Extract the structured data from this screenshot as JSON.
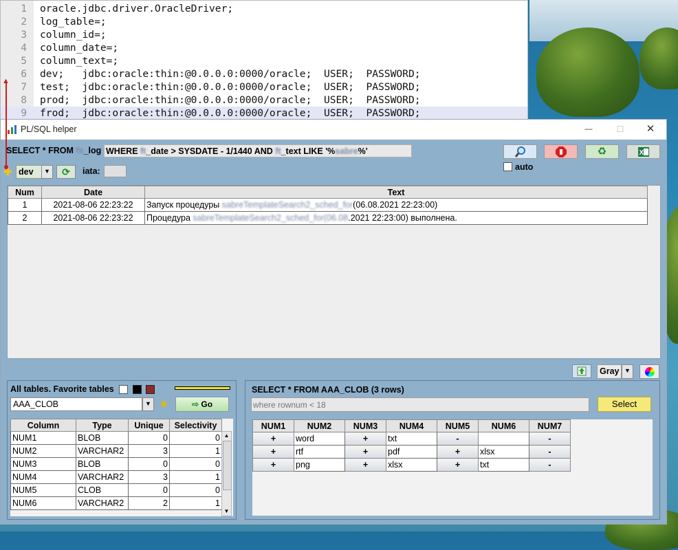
{
  "editor": {
    "lines": [
      {
        "num": "1",
        "text": "oracle.jdbc.driver.OracleDriver;"
      },
      {
        "num": "2",
        "text": "log_table=;"
      },
      {
        "num": "3",
        "text": "column_id=;"
      },
      {
        "num": "4",
        "text": "column_date=;"
      },
      {
        "num": "5",
        "text": "column_text=;"
      },
      {
        "num": "6",
        "text": "dev;   jdbc:oracle:thin:@0.0.0.0:0000/oracle;  USER;  PASSWORD;"
      },
      {
        "num": "7",
        "text": "test;  jdbc:oracle:thin:@0.0.0.0:0000/oracle;  USER;  PASSWORD;"
      },
      {
        "num": "8",
        "text": "prod;  jdbc:oracle:thin:@0.0.0.0:0000/oracle;  USER;  PASSWORD;"
      },
      {
        "num": "9",
        "text": "frod;  jdbc:oracle:thin:@0.0.0.0:0000/oracle;  USER;  PASSWORD;"
      }
    ]
  },
  "window": {
    "title": "PL/SQL helper",
    "minimize": "—",
    "maximize": "☐",
    "close": "✕"
  },
  "toolbar": {
    "sql_prefix": "SELECT * FROM",
    "sql_table_blur": "fs",
    "sql_table_suffix": "_log",
    "sql_where_1": "WHERE",
    "sql_col1_blur": "ft",
    "sql_where_2": "_date > SYSDATE - 1/1440 AND",
    "sql_col2_blur": "ft",
    "sql_where_3": "_text LIKE '%",
    "sql_filter_blur": "sabre",
    "sql_where_4": "%'",
    "auto_label": "auto",
    "icons": [
      "search-icon",
      "stop-icon",
      "recycle-icon",
      "excel-icon"
    ]
  },
  "connection": {
    "env": "dev",
    "iata_label": "iata:",
    "iata_value": ""
  },
  "log_table": {
    "headers": [
      "Num",
      "Date",
      "Text"
    ],
    "rows": [
      {
        "num": "1",
        "date": "2021-08-06 22:23:22",
        "text_a": "Запуск процедуры ",
        "text_blur": "sabreTemplateSearch2_sched_for",
        "text_b": "(06.08.2021 22:23:00)"
      },
      {
        "num": "2",
        "date": "2021-08-06 22:23:22",
        "text_a": "Процедура ",
        "text_blur": "sabreTemplateSearch2_sched_for(06.08",
        "text_b": ".2021 22:23:00) выполнена."
      }
    ]
  },
  "theme": {
    "selected": "Gray"
  },
  "tables_panel": {
    "title": "All tables. Favorite tables",
    "selected_table": "AAA_CLOB",
    "go_label": "Go",
    "headers": [
      "Column",
      "Type",
      "Unique",
      "Selectivity"
    ],
    "rows": [
      {
        "column": "NUM1",
        "type": "BLOB",
        "unique": "0",
        "selectivity": "0"
      },
      {
        "column": "NUM2",
        "type": "VARCHAR2",
        "unique": "3",
        "selectivity": "1"
      },
      {
        "column": "NUM3",
        "type": "BLOB",
        "unique": "0",
        "selectivity": "0"
      },
      {
        "column": "NUM4",
        "type": "VARCHAR2",
        "unique": "3",
        "selectivity": "1"
      },
      {
        "column": "NUM5",
        "type": "CLOB",
        "unique": "0",
        "selectivity": "0"
      },
      {
        "column": "NUM6",
        "type": "VARCHAR2",
        "unique": "2",
        "selectivity": "1"
      }
    ]
  },
  "query_panel": {
    "title": "SELECT * FROM AAA_CLOB (3 rows)",
    "where_placeholder": "where rownum < 18",
    "select_label": "Select",
    "headers": [
      "NUM1",
      "NUM2",
      "NUM3",
      "NUM4",
      "NUM5",
      "NUM6",
      "NUM7"
    ],
    "rows": [
      [
        "+",
        "word",
        "+",
        "txt",
        "-",
        "",
        "-"
      ],
      [
        "+",
        "rtf",
        "+",
        "pdf",
        "+",
        "xlsx",
        "-"
      ],
      [
        "+",
        "png",
        "+",
        "xlsx",
        "+",
        "txt",
        "-"
      ]
    ]
  }
}
